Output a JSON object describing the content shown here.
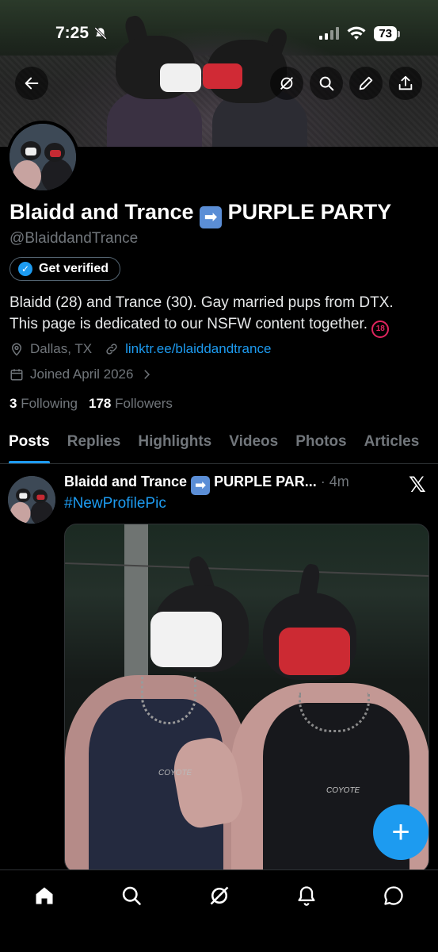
{
  "status_bar": {
    "time": "7:25",
    "battery": "73"
  },
  "profile": {
    "display_name": "Blaidd and Trance",
    "name_suffix": "PURPLE PARTY",
    "handle": "@BlaiddandTrance",
    "verify_label": "Get verified",
    "bio_line1": "Blaidd (28) and Trance (30). Gay married pups from DTX.",
    "bio_line2": "This page is dedicated to our NSFW content together.",
    "nsfw_badge": "18",
    "location": "Dallas, TX",
    "link": "linktr.ee/blaiddandtrance",
    "joined": "Joined April 2026",
    "following_count": "3",
    "following_label": "Following",
    "followers_count": "178",
    "followers_label": "Followers"
  },
  "tabs": [
    "Posts",
    "Replies",
    "Highlights",
    "Videos",
    "Photos",
    "Articles"
  ],
  "post": {
    "author": "Blaidd and Trance",
    "author_suffix": "PURPLE PAR...",
    "time": "· 4m",
    "text": "#NewProfilePic",
    "logo_a": "COYOTE",
    "logo_b": "COYOTE"
  },
  "icons": {
    "back": "back-arrow-icon",
    "grok": "grok-icon",
    "search": "search-icon",
    "edit": "pencil-icon",
    "share": "share-icon",
    "location": "location-pin-icon",
    "link": "link-icon",
    "calendar": "calendar-icon",
    "x_logo": "x-logo-icon",
    "fab": "plus-icon",
    "nav_home": "home-icon",
    "nav_search": "search-icon",
    "nav_grok": "grok-icon",
    "nav_notifications": "bell-icon",
    "nav_messages": "message-icon"
  },
  "colors": {
    "accent": "#1d9bf0",
    "background": "#000000",
    "muted": "#71767b"
  }
}
